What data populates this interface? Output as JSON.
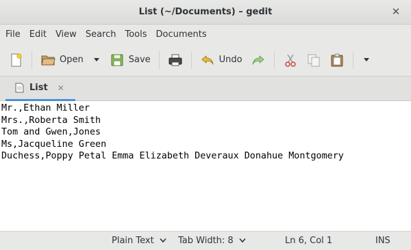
{
  "window": {
    "title": "List (~/Documents) – gedit"
  },
  "menubar": {
    "items": [
      "File",
      "Edit",
      "View",
      "Search",
      "Tools",
      "Documents"
    ]
  },
  "toolbar": {
    "open_label": "Open",
    "save_label": "Save",
    "undo_label": "Undo"
  },
  "tab": {
    "label": "List"
  },
  "editor": {
    "lines": [
      "Mr.,Ethan Miller",
      "Mrs.,Roberta Smith",
      "Tom and Gwen,Jones",
      "Ms,Jacqueline Green",
      "Duchess,Poppy Petal Emma Elizabeth Deveraux Donahue Montgomery"
    ]
  },
  "statusbar": {
    "language": "Plain Text",
    "tab_width": "Tab Width: 8",
    "position": "Ln 6, Col 1",
    "mode": "INS"
  }
}
